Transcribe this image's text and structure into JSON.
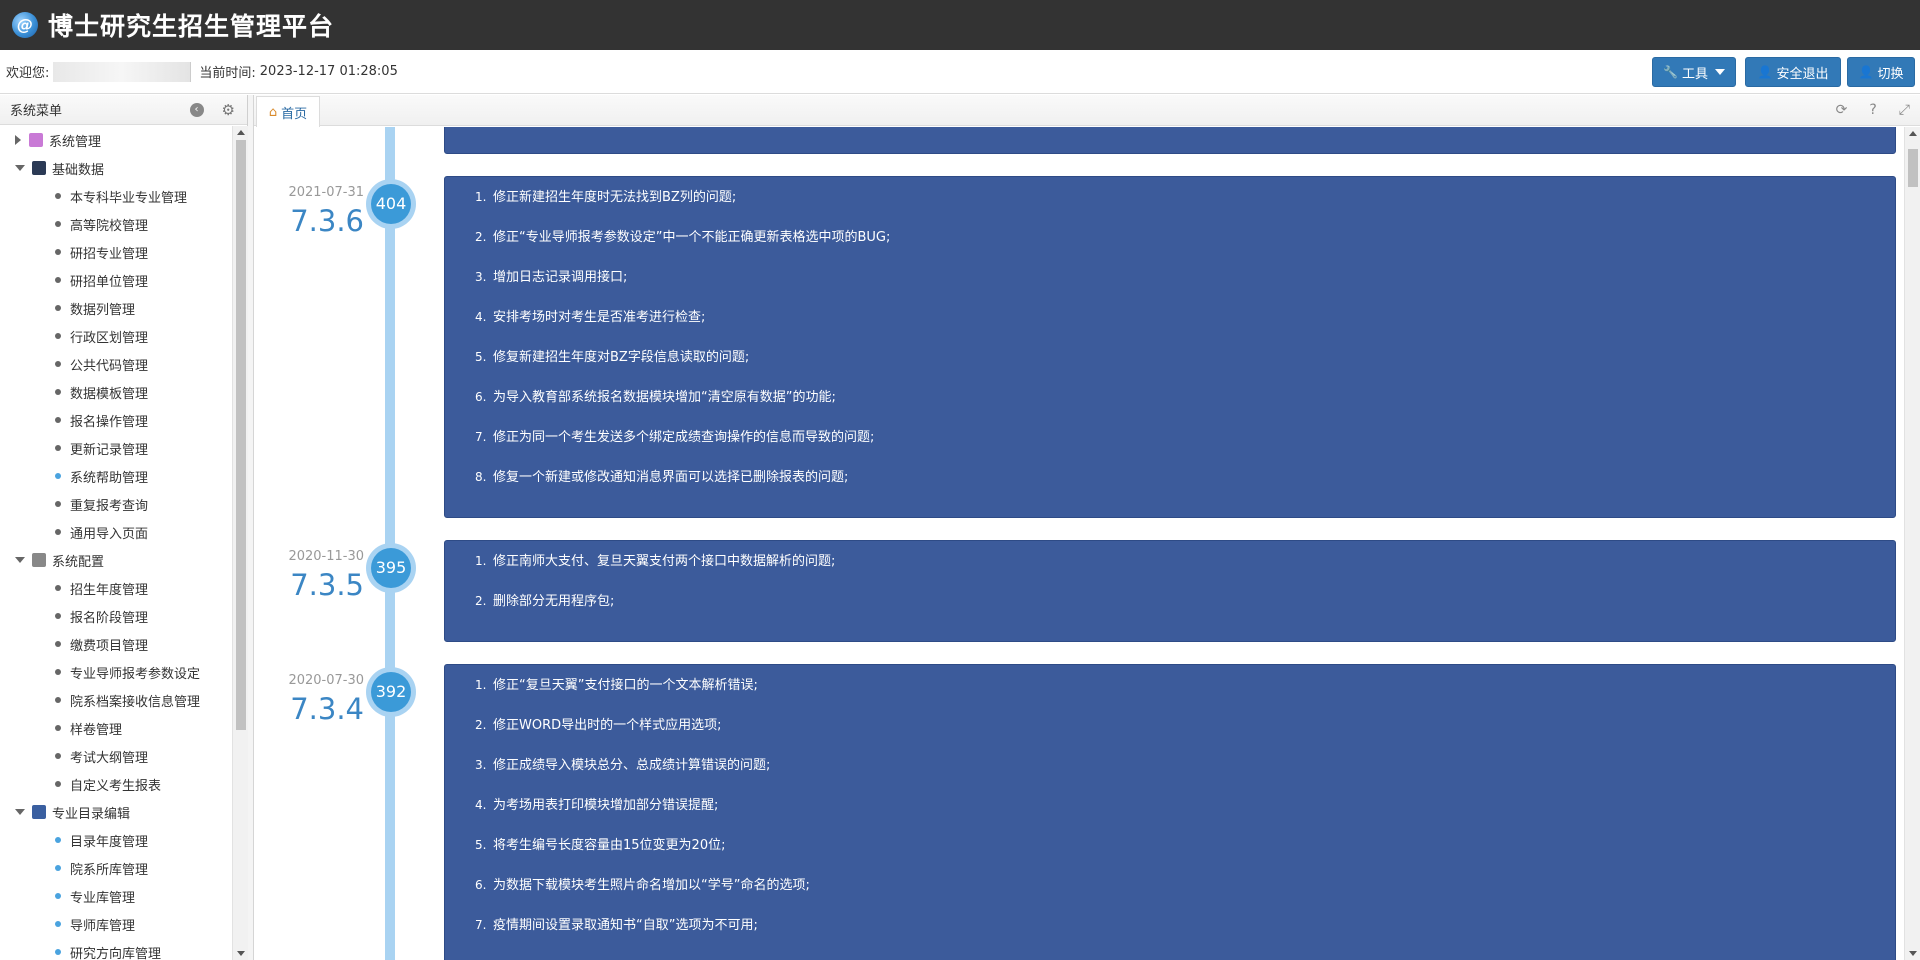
{
  "header": {
    "logo_letter": "@",
    "title": "博士研究生招生管理平台"
  },
  "info": {
    "welcome_label": "欢迎您:",
    "time_label": "当前时间:",
    "time_value": "2023-12-17 01:28:05"
  },
  "buttons": {
    "tools": "工具",
    "logout": "安全退出",
    "switch": "切换"
  },
  "sidebar": {
    "title": "系统菜单",
    "groups": [
      {
        "label": "系统管理",
        "expanded": false,
        "items": []
      },
      {
        "label": "基础数据",
        "expanded": true,
        "items": [
          "本专科毕业专业管理",
          "高等院校管理",
          "研招专业管理",
          "研招单位管理",
          "数据列管理",
          "行政区划管理",
          "公共代码管理",
          "数据模板管理",
          "报名操作管理",
          "更新记录管理",
          "系统帮助管理",
          "重复报考查询",
          "通用导入页面"
        ]
      },
      {
        "label": "系统配置",
        "expanded": true,
        "items": [
          "招生年度管理",
          "报名阶段管理",
          "缴费项目管理",
          "专业导师报考参数设定",
          "院系档案接收信息管理",
          "样卷管理",
          "考试大纲管理",
          "自定义考生报表"
        ]
      },
      {
        "label": "专业目录编辑",
        "expanded": true,
        "items": [
          "目录年度管理",
          "院系所库管理",
          "专业库管理",
          "导师库管理",
          "研究方向库管理"
        ]
      }
    ]
  },
  "tabs": {
    "home": "首页"
  },
  "timeline": [
    {
      "date": "2021-07-31",
      "version": "7.3.6",
      "badge": "404",
      "items": [
        "修正新建招生年度时无法找到BZ列的问题;",
        "修正“专业导师报考参数设定”中一个不能正确更新表格选中项的BUG;",
        "增加日志记录调用接口;",
        "安排考场时对考生是否准考进行检查;",
        "修复新建招生年度对BZ字段信息读取的问题;",
        "为导入教育部系统报名数据模块增加“清空原有数据”的功能;",
        "修正为同一个考生发送多个绑定成绩查询操作的信息而导致的问题;",
        "修复一个新建或修改通知消息界面可以选择已删除报表的问题;"
      ]
    },
    {
      "date": "2020-11-30",
      "version": "7.3.5",
      "badge": "395",
      "items": [
        "修正南师大支付、复旦天翼支付两个接口中数据解析的问题;",
        "删除部分无用程序包;"
      ]
    },
    {
      "date": "2020-07-30",
      "version": "7.3.4",
      "badge": "392",
      "items": [
        "修正“复旦天翼”支付接口的一个文本解析错误;",
        "修正WORD导出时的一个样式应用选项;",
        "修正成绩导入模块总分、总成绩计算错误的问题;",
        "为考场用表打印模块增加部分错误提醒;",
        "将考生编号长度容量由15位变更为20位;",
        "为数据下载模块考生照片命名增加以“学号”命名的选项;",
        "疫情期间设置录取通知书“自取”选项为不可用;"
      ]
    }
  ],
  "colors": {
    "accent": "#3279b7",
    "card": "#3c5b9b",
    "timeline": "#a9d3f2",
    "badge": "#3b9ad8",
    "version": "#3b86c4"
  },
  "icons": {
    "group_icons": [
      "users-icon",
      "terminal-icon",
      "gear-icon",
      "book-icon"
    ]
  }
}
